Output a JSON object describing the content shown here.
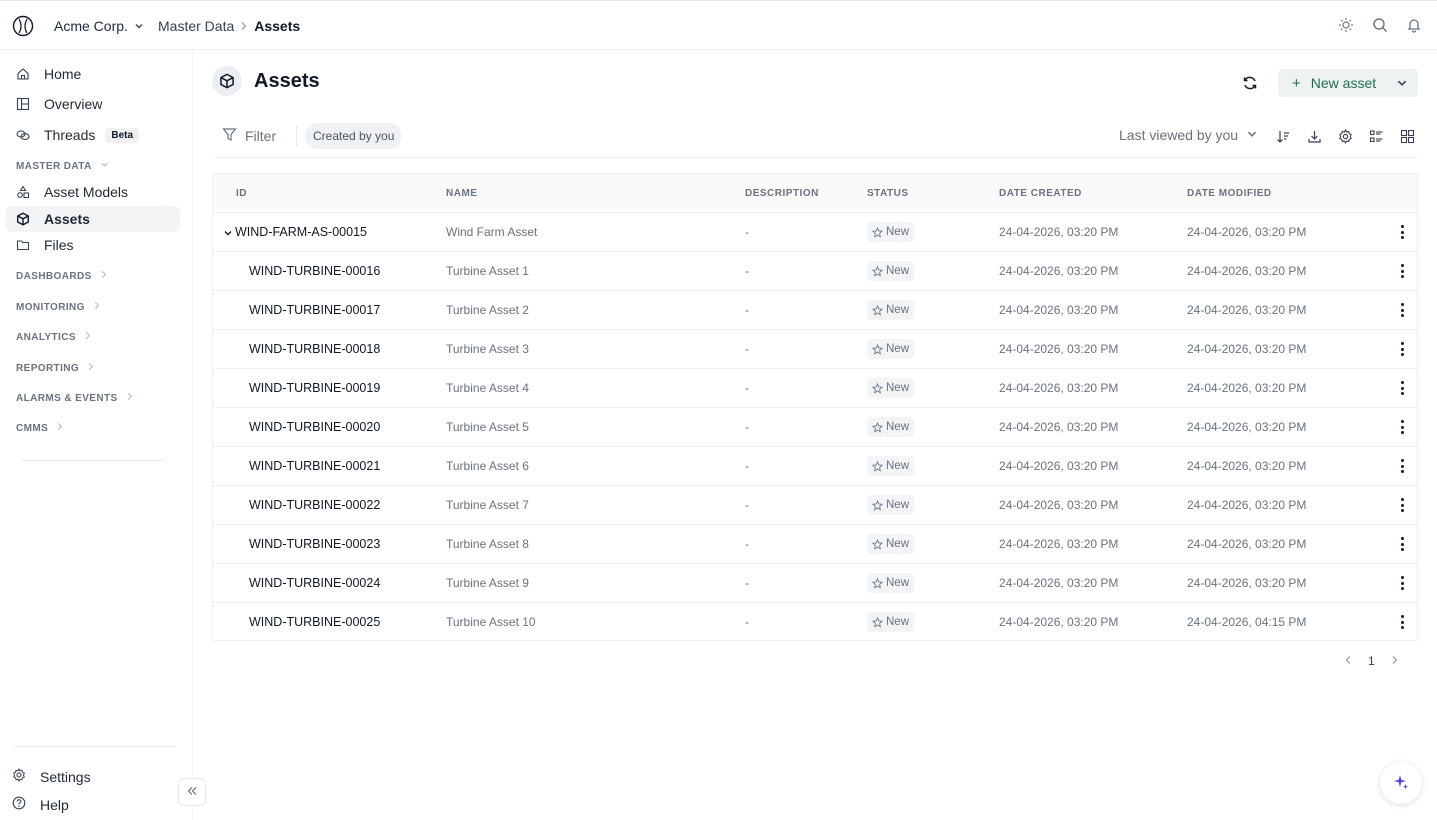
{
  "header": {
    "org": "Acme Corp.",
    "breadcrumb": [
      "Master Data",
      "Assets"
    ]
  },
  "sidebar": {
    "top_items": [
      {
        "label": "Home",
        "icon": "home-icon"
      },
      {
        "label": "Overview",
        "icon": "overview-icon"
      },
      {
        "label": "Threads",
        "icon": "threads-icon",
        "badge": "Beta"
      }
    ],
    "master_data": {
      "label": "MASTER DATA",
      "items": [
        {
          "label": "Asset Models",
          "icon": "asset-models-icon"
        },
        {
          "label": "Assets",
          "icon": "cube-icon",
          "active": true
        },
        {
          "label": "Files",
          "icon": "folder-icon"
        }
      ]
    },
    "sections": [
      "DASHBOARDS",
      "MONITORING",
      "ANALYTICS",
      "REPORTING",
      "ALARMS & EVENTS",
      "CMMS"
    ],
    "bottom": {
      "settings": "Settings",
      "help": "Help"
    }
  },
  "page": {
    "title": "Assets",
    "new_button": "New asset",
    "filter_label": "Filter",
    "chip": "Created by you",
    "sort": "Last viewed by you"
  },
  "table": {
    "columns": [
      "ID",
      "NAME",
      "DESCRIPTION",
      "STATUS",
      "DATE CREATED",
      "DATE MODIFIED"
    ],
    "rows": [
      {
        "id": "WIND-FARM-AS-00015",
        "name": "Wind Farm Asset",
        "desc": "-",
        "status": "New",
        "created": "24-04-2026, 03:20 PM",
        "modified": "24-04-2026, 03:20 PM",
        "parent": true
      },
      {
        "id": "WIND-TURBINE-00016",
        "name": "Turbine Asset 1",
        "desc": "-",
        "status": "New",
        "created": "24-04-2026, 03:20 PM",
        "modified": "24-04-2026, 03:20 PM"
      },
      {
        "id": "WIND-TURBINE-00017",
        "name": "Turbine Asset 2",
        "desc": "-",
        "status": "New",
        "created": "24-04-2026, 03:20 PM",
        "modified": "24-04-2026, 03:20 PM"
      },
      {
        "id": "WIND-TURBINE-00018",
        "name": "Turbine Asset 3",
        "desc": "-",
        "status": "New",
        "created": "24-04-2026, 03:20 PM",
        "modified": "24-04-2026, 03:20 PM"
      },
      {
        "id": "WIND-TURBINE-00019",
        "name": "Turbine Asset 4",
        "desc": "-",
        "status": "New",
        "created": "24-04-2026, 03:20 PM",
        "modified": "24-04-2026, 03:20 PM"
      },
      {
        "id": "WIND-TURBINE-00020",
        "name": "Turbine Asset 5",
        "desc": "-",
        "status": "New",
        "created": "24-04-2026, 03:20 PM",
        "modified": "24-04-2026, 03:20 PM"
      },
      {
        "id": "WIND-TURBINE-00021",
        "name": "Turbine Asset 6",
        "desc": "-",
        "status": "New",
        "created": "24-04-2026, 03:20 PM",
        "modified": "24-04-2026, 03:20 PM"
      },
      {
        "id": "WIND-TURBINE-00022",
        "name": "Turbine Asset 7",
        "desc": "-",
        "status": "New",
        "created": "24-04-2026, 03:20 PM",
        "modified": "24-04-2026, 03:20 PM"
      },
      {
        "id": "WIND-TURBINE-00023",
        "name": "Turbine Asset 8",
        "desc": "-",
        "status": "New",
        "created": "24-04-2026, 03:20 PM",
        "modified": "24-04-2026, 03:20 PM"
      },
      {
        "id": "WIND-TURBINE-00024",
        "name": "Turbine Asset 9",
        "desc": "-",
        "status": "New",
        "created": "24-04-2026, 03:20 PM",
        "modified": "24-04-2026, 03:20 PM"
      },
      {
        "id": "WIND-TURBINE-00025",
        "name": "Turbine Asset 10",
        "desc": "-",
        "status": "New",
        "created": "24-04-2026, 03:20 PM",
        "modified": "24-04-2026, 04:15 PM"
      }
    ]
  },
  "pagination": {
    "current": "1"
  },
  "colors": {
    "accent": "#1f6f4f",
    "button_bg": "#eef2f0",
    "active_nav": "#f3f4f6",
    "fab_icon": "#4f46e5"
  }
}
